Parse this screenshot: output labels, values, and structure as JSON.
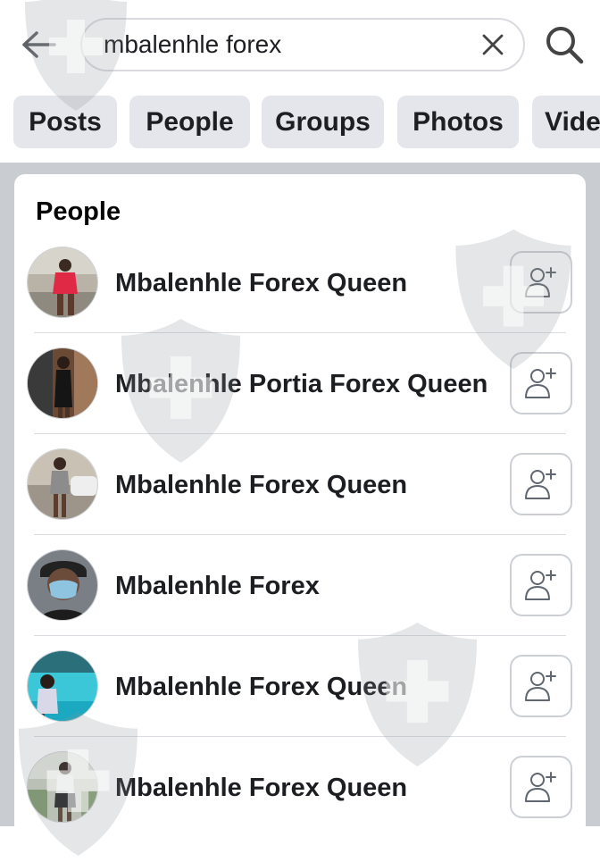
{
  "header": {
    "back_icon": "arrow-left-icon",
    "search_value": "mbalenhle forex",
    "clear_icon": "close-icon",
    "search_icon": "search-icon"
  },
  "filters": [
    "Posts",
    "People",
    "Groups",
    "Photos",
    "Videos"
  ],
  "people_section": {
    "title": "People",
    "add_friend_icon": "add-friend-icon",
    "results": [
      {
        "name": "Mbalenhle Forex Queen",
        "avatar": "photo"
      },
      {
        "name": "Mbalenhle Portia Forex Queen",
        "avatar": "photo"
      },
      {
        "name": "Mbalenhle Forex Queen",
        "avatar": "photo"
      },
      {
        "name": "Mbalenhle Forex",
        "avatar": "photo"
      },
      {
        "name": "Mbalenhle Forex Queen",
        "avatar": "photo"
      },
      {
        "name": "Mbalenhle Forex Queen",
        "avatar": "photo"
      }
    ]
  },
  "colors": {
    "chip_bg": "#e4e6eb",
    "feed_bg": "#c9ccd1",
    "text": "#1c1e21",
    "watermark": "#8a8d91"
  }
}
